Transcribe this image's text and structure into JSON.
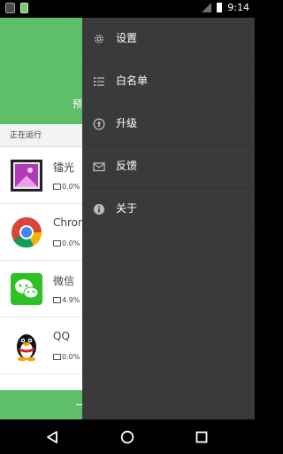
{
  "status": {
    "time": "9:14"
  },
  "header": {
    "preview_label": "预"
  },
  "section": {
    "running_label": "正在运行"
  },
  "apps": [
    {
      "name": "镭光",
      "usage": "0.0%",
      "icon": "photo-app-icon"
    },
    {
      "name": "Chrom",
      "usage": "0.0%",
      "icon": "chrome-icon"
    },
    {
      "name": "微信",
      "usage": "4.9%",
      "icon": "wechat-icon"
    },
    {
      "name": "QQ",
      "usage": "0.0%",
      "icon": "qq-penguin-icon"
    }
  ],
  "drawer": {
    "items": [
      {
        "label": "设置",
        "icon": "gear-icon"
      },
      {
        "label": "白名单",
        "icon": "list-icon"
      },
      {
        "label": "升级",
        "icon": "upgrade-arrow-icon"
      },
      {
        "label": "反馈",
        "icon": "mail-icon"
      },
      {
        "label": "关于",
        "icon": "info-icon"
      }
    ]
  },
  "colors": {
    "accent": "#5fbf69",
    "drawer_bg": "#3a3a3a"
  }
}
